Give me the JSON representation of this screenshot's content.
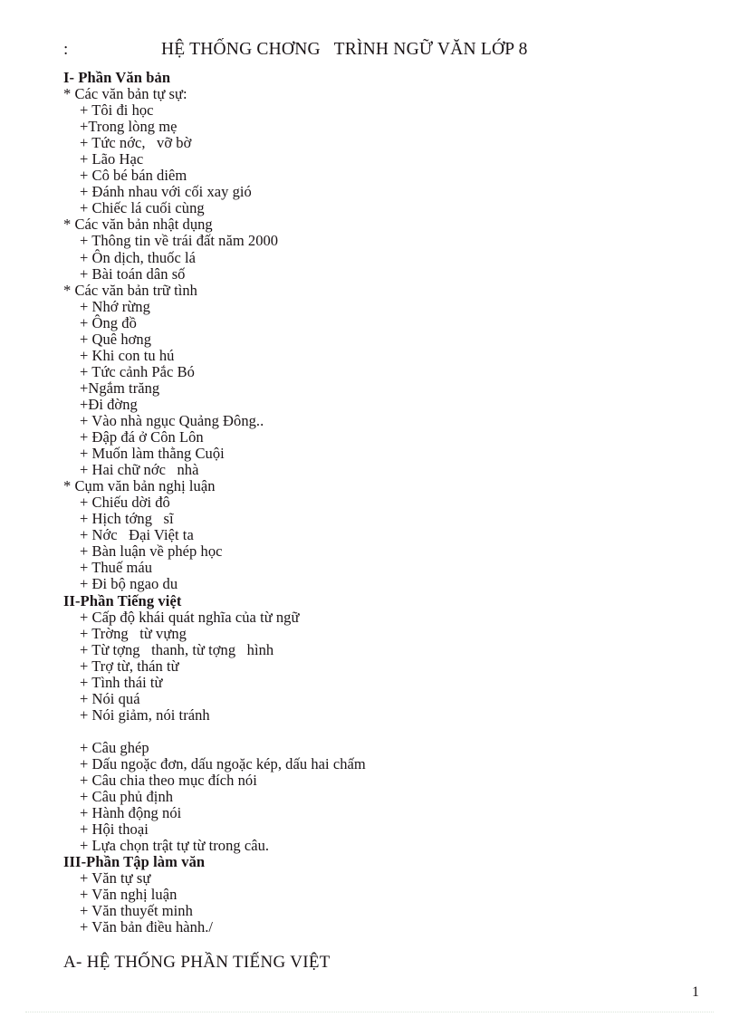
{
  "header": {
    "left_marker": ":",
    "title": "HỆ THỐNG CHƠNG   TRÌNH NGỮ VĂN LỚP 8"
  },
  "document": {
    "lines": [
      {
        "kind": "heading",
        "text": "I- Phần Văn bản"
      },
      {
        "kind": "star",
        "text": "* Các văn bản tự sự:"
      },
      {
        "kind": "plus",
        "text": "+ Tôi đi học"
      },
      {
        "kind": "plus",
        "text": "+Trong lòng mẹ"
      },
      {
        "kind": "plus",
        "text": "+ Tức nớc,   vỡ bờ"
      },
      {
        "kind": "plus",
        "text": "+ Lão Hạc"
      },
      {
        "kind": "plus",
        "text": "+ Cô bé bán diêm"
      },
      {
        "kind": "plus",
        "text": "+ Đánh nhau với cối xay gió"
      },
      {
        "kind": "plus",
        "text": "+ Chiếc lá cuối cùng"
      },
      {
        "kind": "star",
        "text": "* Các văn bản nhật dụng"
      },
      {
        "kind": "plus",
        "text": "+ Thông tin về trái đất năm 2000"
      },
      {
        "kind": "plus",
        "text": "+ Ôn dịch, thuốc lá"
      },
      {
        "kind": "plus",
        "text": "+ Bài toán dân số"
      },
      {
        "kind": "star",
        "text": "* Các văn bản trữ tình"
      },
      {
        "kind": "plus",
        "text": "+ Nhớ rừng"
      },
      {
        "kind": "plus",
        "text": "+ Ông đồ"
      },
      {
        "kind": "plus",
        "text": "+ Quê hơng"
      },
      {
        "kind": "plus",
        "text": "+ Khi con tu hú"
      },
      {
        "kind": "plus",
        "text": "+ Tức cảnh Pắc Bó"
      },
      {
        "kind": "plus",
        "text": "+Ngắm trăng"
      },
      {
        "kind": "plus",
        "text": "+Đi đờng"
      },
      {
        "kind": "plus",
        "text": "+ Vào nhà ngục Quảng Đông.."
      },
      {
        "kind": "plus",
        "text": "+ Đập đá ở Côn Lôn"
      },
      {
        "kind": "plus",
        "text": "+ Muốn làm thằng Cuội"
      },
      {
        "kind": "plus",
        "text": "+ Hai chữ nớc   nhà"
      },
      {
        "kind": "star",
        "text": "* Cụm văn bản nghị luận"
      },
      {
        "kind": "plus",
        "text": "+ Chiếu dời đô"
      },
      {
        "kind": "plus",
        "text": "+ Hịch tớng   sĩ"
      },
      {
        "kind": "plus",
        "text": "+ Nớc   Đại Việt ta"
      },
      {
        "kind": "plus",
        "text": "+ Bàn luận về phép học"
      },
      {
        "kind": "plus",
        "text": "+ Thuế máu"
      },
      {
        "kind": "plus",
        "text": "+ Đi bộ ngao du"
      },
      {
        "kind": "heading",
        "text": "II-Phần Tiếng việt"
      },
      {
        "kind": "plus",
        "text": "+ Cấp độ khái quát nghĩa của từ ngữ"
      },
      {
        "kind": "plus",
        "text": "+ Trờng   từ vựng"
      },
      {
        "kind": "plus",
        "text": "+ Từ tợng   thanh, từ tợng   hình"
      },
      {
        "kind": "plus",
        "text": "+ Trợ từ, thán từ"
      },
      {
        "kind": "plus",
        "text": "+ Tình thái từ"
      },
      {
        "kind": "plus",
        "text": "+ Nói quá"
      },
      {
        "kind": "plus",
        "text": "+ Nói giảm, nói tránh"
      },
      {
        "kind": "blank",
        "text": ""
      },
      {
        "kind": "plus",
        "text": "+ Câu ghép"
      },
      {
        "kind": "plus",
        "text": "+ Dấu ngoặc đơn, dấu ngoặc kép, dấu hai chấm"
      },
      {
        "kind": "plus",
        "text": "+ Câu chia theo mục đích nói"
      },
      {
        "kind": "plus",
        "text": "+ Câu phủ định"
      },
      {
        "kind": "plus",
        "text": "+ Hành động nói"
      },
      {
        "kind": "plus",
        "text": "+ Hội thoại"
      },
      {
        "kind": "plus",
        "text": "+ Lựa chọn trật tự từ trong câu."
      },
      {
        "kind": "heading",
        "text": "III-Phần Tập làm văn"
      },
      {
        "kind": "plus",
        "text": "+ Văn tự sự"
      },
      {
        "kind": "plus",
        "text": "+ Văn nghị luận"
      },
      {
        "kind": "plus",
        "text": "+ Văn thuyết minh"
      },
      {
        "kind": "plus",
        "text": "+ Văn bản điều hành./"
      }
    ]
  },
  "section_a": {
    "text": "A- HỆ THỐNG PHẦN TIẾNG VIỆT"
  },
  "footer": {
    "page_number": "1"
  }
}
